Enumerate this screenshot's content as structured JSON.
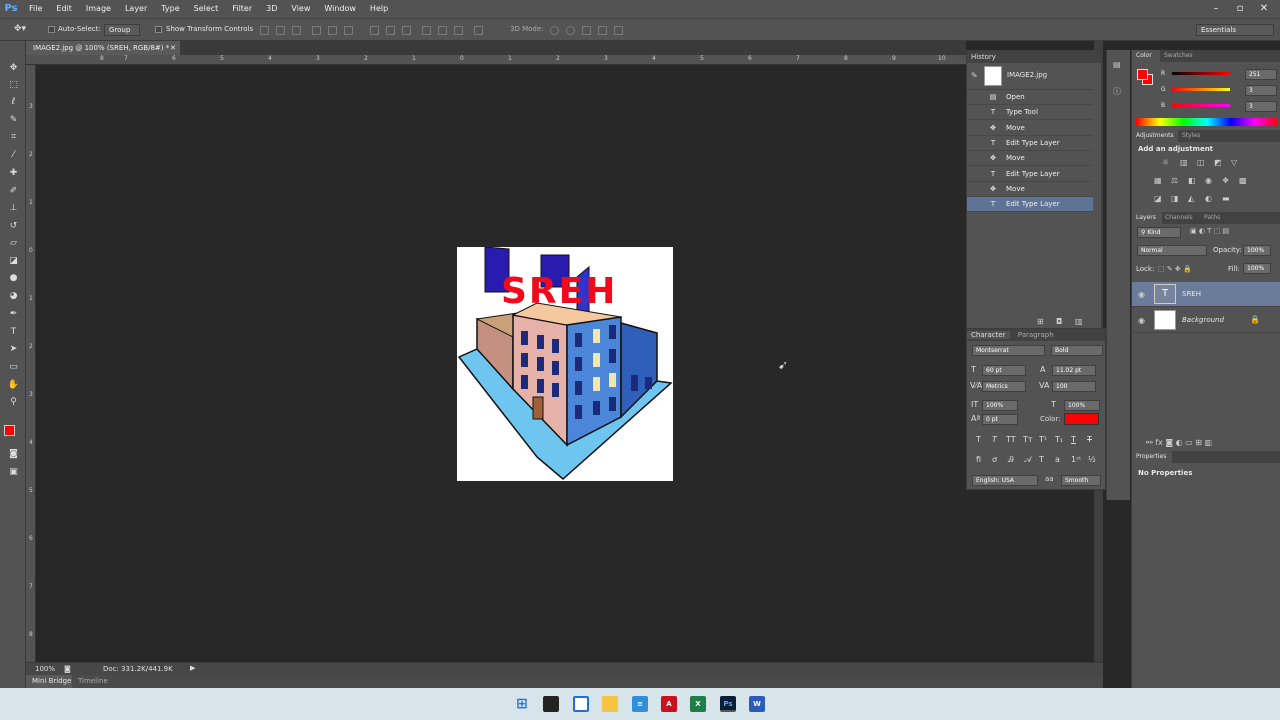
{
  "menubar": {
    "logo": "Ps",
    "items": [
      "File",
      "Edit",
      "Image",
      "Layer",
      "Type",
      "Select",
      "Filter",
      "3D",
      "View",
      "Window",
      "Help"
    ]
  },
  "options": {
    "auto_select": "Auto-Select:",
    "group": "Group",
    "show_transform": "Show Transform Controls",
    "mode_3d": "3D Mode:",
    "workspace": "Essentials"
  },
  "document": {
    "tab_title": "IMAGE2.jpg @ 100% (SREH, RGB/8#) *",
    "ruler_top": [
      "8",
      "7",
      "6",
      "5",
      "4",
      "3",
      "2",
      "1",
      "0",
      "1",
      "2",
      "3",
      "4",
      "5",
      "6",
      "7",
      "8",
      "9",
      "10"
    ],
    "ruler_left": [
      "3",
      "2",
      "1",
      "0",
      "1",
      "2",
      "3",
      "4",
      "5",
      "6",
      "7",
      "8"
    ],
    "artwork_text": "SREH",
    "zoom": "100%",
    "doc_size": "Doc: 331.2K/441.9K",
    "bottom_tabs": [
      "Mini Bridge",
      "Timeline"
    ]
  },
  "history": {
    "tab": "History",
    "snapshot": "IMAGE2.jpg",
    "items": [
      {
        "icon": "doc",
        "label": "Open"
      },
      {
        "icon": "T",
        "label": "Type Tool"
      },
      {
        "icon": "move",
        "label": "Move"
      },
      {
        "icon": "T",
        "label": "Edit Type Layer"
      },
      {
        "icon": "move",
        "label": "Move"
      },
      {
        "icon": "T",
        "label": "Edit Type Layer"
      },
      {
        "icon": "move",
        "label": "Move"
      },
      {
        "icon": "T",
        "label": "Edit Type Layer"
      }
    ],
    "selected_index": 7
  },
  "character": {
    "tabs": [
      "Character",
      "Paragraph"
    ],
    "font_family": "Montserrat",
    "font_style": "Bold",
    "size": "60 pt",
    "leading": "11.02 pt",
    "kerning": "Metrics",
    "tracking": "100",
    "vscale": "100%",
    "hscale": "100%",
    "baseline": "0 pt",
    "color_label": "Color:",
    "language": "English: USA",
    "antialias": "Smooth",
    "swatch_color": "#fb0303"
  },
  "color_panel": {
    "tabs": [
      "Color",
      "Swatches"
    ],
    "r_label": "R",
    "g_label": "G",
    "b_label": "B",
    "r": "251",
    "g": "3",
    "b": "3",
    "foreground": "#fb0303"
  },
  "adjustments": {
    "tabs": [
      "Adjustments",
      "Styles"
    ],
    "heading": "Add an adjustment"
  },
  "layers": {
    "tabs": [
      "Layers",
      "Channels",
      "Paths"
    ],
    "kind": "Kind",
    "blend": "Normal",
    "opacity_label": "Opacity:",
    "opacity": "100%",
    "lock_label": "Lock:",
    "fill_label": "Fill:",
    "fill": "100%",
    "items": [
      {
        "name": "SREH",
        "type": "text",
        "selected": true
      },
      {
        "name": "Background",
        "type": "image",
        "selected": false
      }
    ]
  },
  "properties": {
    "tab": "Properties",
    "text": "No Properties"
  },
  "taskbar": {
    "apps": [
      "windows-start",
      "task-view",
      "snap",
      "file-explorer",
      "notepad",
      "acrobat",
      "excel",
      "photoshop",
      "word"
    ]
  }
}
